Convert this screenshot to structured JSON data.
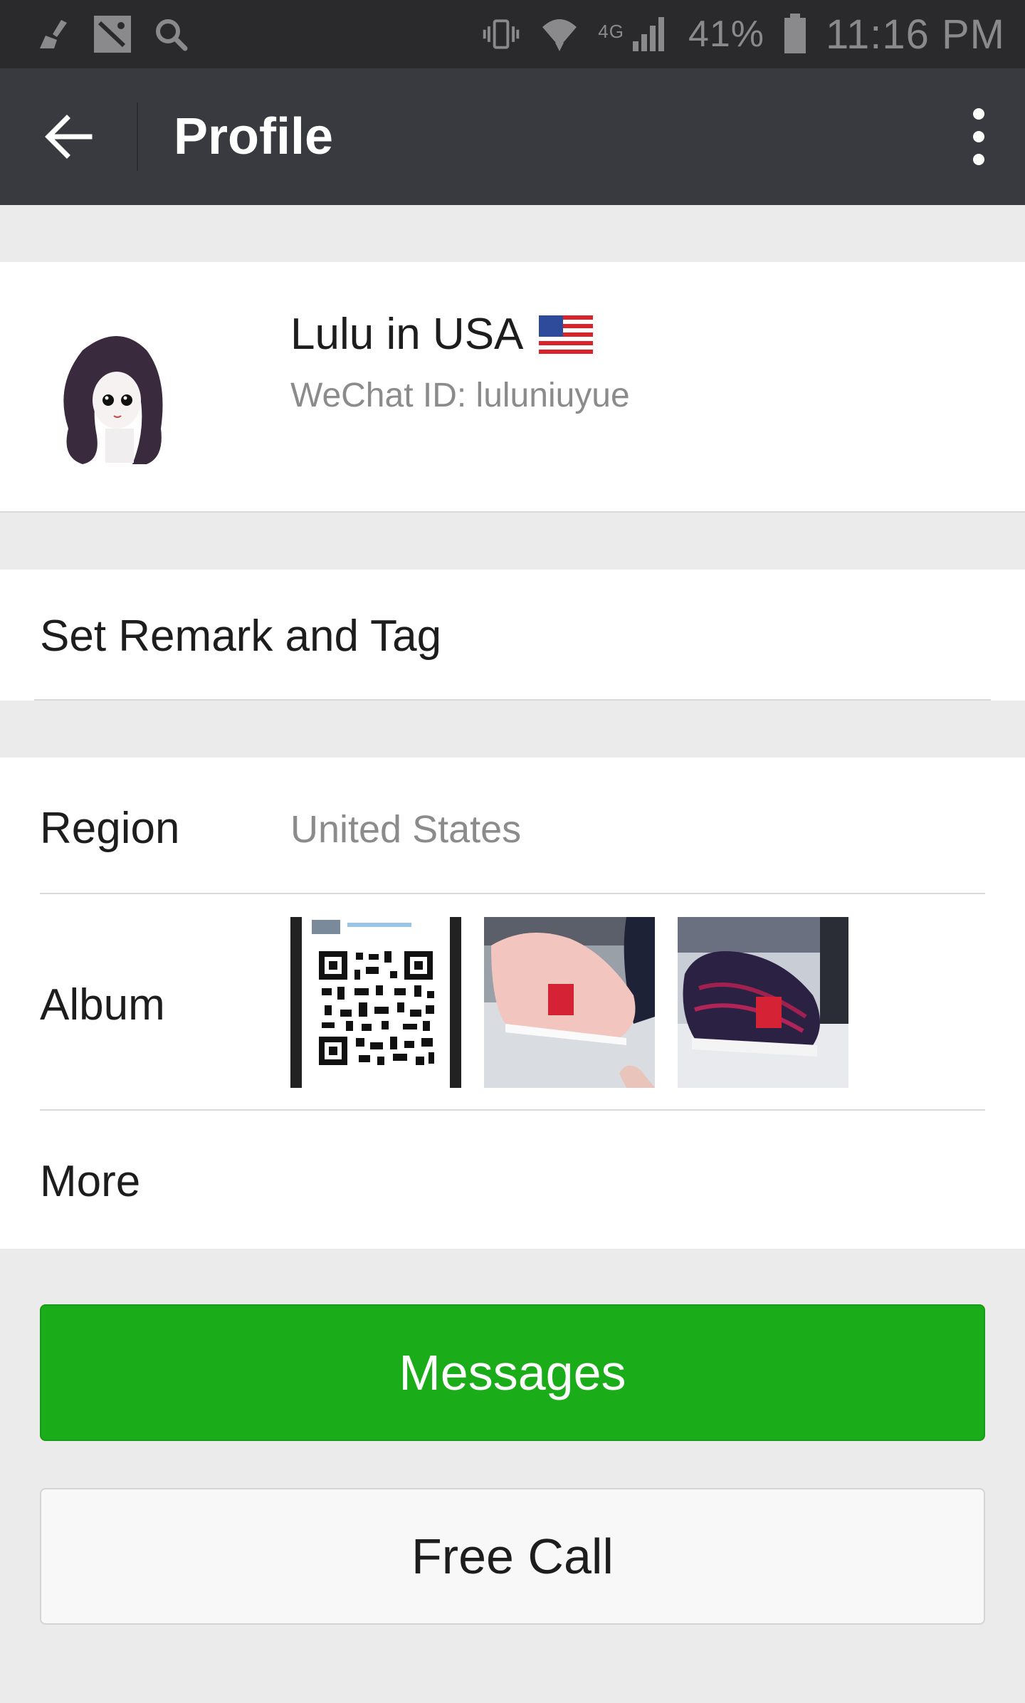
{
  "status_bar": {
    "battery_percent": "41%",
    "network": "4G",
    "time": "11:16 PM",
    "icons": [
      "broom-icon",
      "image-icon",
      "search-icon",
      "vibrate-icon",
      "wifi-icon",
      "signal-icon",
      "battery-icon"
    ]
  },
  "app_bar": {
    "title": "Profile",
    "back_icon": "arrow-left-icon",
    "menu_icon": "more-vertical-icon"
  },
  "profile": {
    "name": "Lulu in USA",
    "flag": "us-flag-emoji",
    "wechat_id": "WeChat ID: luluniuyue"
  },
  "remark": {
    "label": "Set Remark and Tag"
  },
  "info": {
    "region_label": "Region",
    "region_value": "United States",
    "album_label": "Album",
    "album_items": [
      "qr-code-image",
      "pink-sneaker-image",
      "navy-sneaker-image"
    ],
    "more_label": "More"
  },
  "actions": {
    "messages_label": "Messages",
    "free_call_label": "Free Call"
  },
  "colors": {
    "status_bar": "#2a2a2c",
    "app_bar": "#393a3f",
    "background": "#ebebeb",
    "primary_green": "#1aad19",
    "secondary_text": "#8b8b8b"
  }
}
